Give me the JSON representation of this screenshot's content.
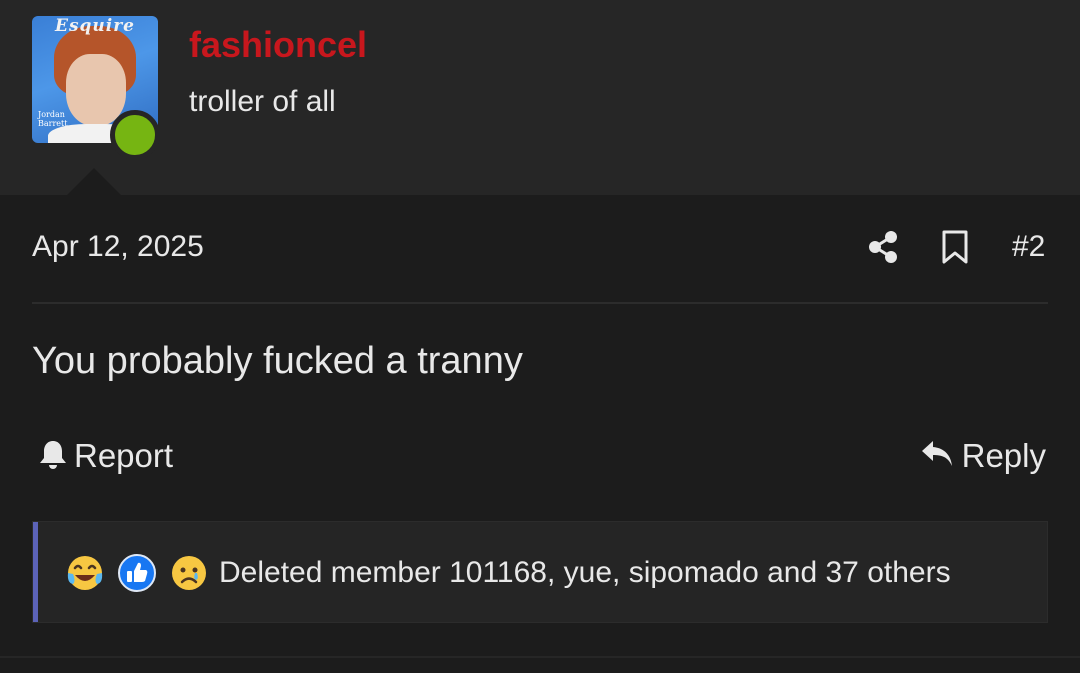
{
  "post": {
    "author": {
      "username": "fashioncel",
      "user_title": "troller of all",
      "avatar": {
        "masthead": "Esquire",
        "caption": "Jordan Barrett"
      },
      "online": true,
      "username_color": "#c8171d",
      "online_color": "#76b512"
    },
    "date": "Apr 12, 2025",
    "number": "#2",
    "message": "You probably fucked a tranny",
    "actions": {
      "report_label": "Report",
      "reply_label": "Reply"
    },
    "reactions": {
      "icons": [
        "laughing-crying-icon",
        "like-icon",
        "sad-icon"
      ],
      "summary": "Deleted member 101168, yue, sipomado and 37 others",
      "accent_color": "#5c63b8"
    }
  }
}
